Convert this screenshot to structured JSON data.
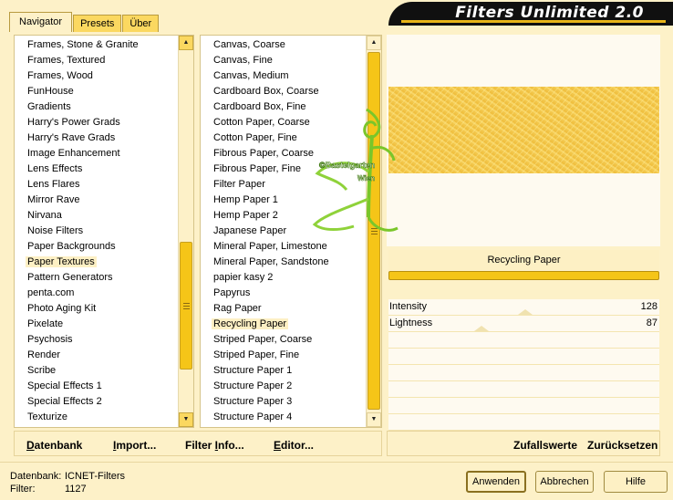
{
  "tabs": [
    "Navigator",
    "Presets",
    "Über"
  ],
  "app_title": "Filters Unlimited 2.0",
  "categories": [
    "Frames, Stone & Granite",
    "Frames, Textured",
    "Frames, Wood",
    "FunHouse",
    "Gradients",
    "Harry's Power Grads",
    "Harry's Rave Grads",
    "Image Enhancement",
    "Lens Effects",
    "Lens Flares",
    "Mirror Rave",
    "Nirvana",
    "Noise Filters",
    "Paper Backgrounds",
    "Paper Textures",
    "Pattern Generators",
    "penta.com",
    "Photo Aging Kit",
    "Pixelate",
    "Psychosis",
    "Render",
    "Scribe",
    "Special Effects 1",
    "Special Effects 2",
    "Texturize"
  ],
  "selected_category": "Paper Textures",
  "filters": [
    "Canvas, Coarse",
    "Canvas, Fine",
    "Canvas, Medium",
    "Cardboard Box, Coarse",
    "Cardboard Box, Fine",
    "Cotton Paper, Coarse",
    "Cotton Paper, Fine",
    "Fibrous Paper, Coarse",
    "Fibrous Paper, Fine",
    "Filter Paper",
    "Hemp Paper 1",
    "Hemp Paper 2",
    "Japanese Paper",
    "Mineral Paper, Limestone",
    "Mineral Paper, Sandstone",
    "papier kasy 2",
    "Papyrus",
    "Rag Paper",
    "Recycling Paper",
    "Striped Paper, Coarse",
    "Striped Paper, Fine",
    "Structure Paper 1",
    "Structure Paper 2",
    "Structure Paper 3",
    "Structure Paper 4"
  ],
  "selected_filter": "Recycling Paper",
  "left_buttons": [
    {
      "first": "D",
      "rest": "atenbank"
    },
    {
      "first": "I",
      "rest": "mport..."
    },
    {
      "first": "",
      "rest": "Filter ",
      "u": "I",
      "tail": "nfo..."
    },
    {
      "first": "E",
      "rest": "ditor..."
    }
  ],
  "right_buttons": [
    "Zufallswerte",
    "Zurücksetzen"
  ],
  "watermark": {
    "line1": "©Bastelgarten",
    "line2": "Wien"
  },
  "filter_name": "Recycling Paper",
  "params": [
    {
      "label": "Intensity",
      "value": "128"
    },
    {
      "label": "Lightness",
      "value": "87"
    }
  ],
  "status": {
    "db_label": "Datenbank:",
    "db_value": "ICNET-Filters",
    "filter_label": "Filter:",
    "filter_value": "1127"
  },
  "dialog_buttons": {
    "apply": "Anwenden",
    "cancel": "Abbrechen",
    "help": "Hilfe"
  },
  "colors": {
    "accent": "#f5c518",
    "panel": "#fdf1c8",
    "title_bg": "#101010"
  }
}
